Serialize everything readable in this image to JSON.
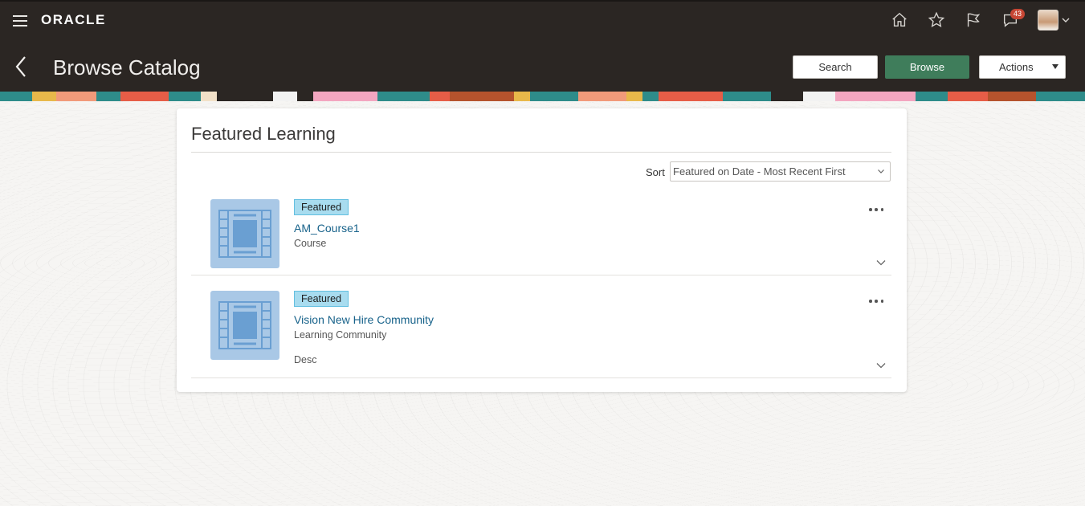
{
  "header": {
    "logo": "ORACLE",
    "page_title": "Browse Catalog",
    "notifications_count": "43",
    "buttons": {
      "search": "Search",
      "browse": "Browse",
      "actions": "Actions"
    },
    "icons": [
      "home-icon",
      "favorites-star-icon",
      "flag-icon",
      "notifications-icon",
      "user-avatar",
      "chevron-down-icon"
    ]
  },
  "colors": {
    "header_bg": "#2b2623",
    "browse_button": "#3f7d5b",
    "link": "#17628a",
    "featured_tag_bg": "#a8dcef",
    "thumbnail_bg": "#a9c8e6",
    "badge": "#c74634"
  },
  "main": {
    "section_title": "Featured Learning",
    "sort": {
      "label": "Sort",
      "selected": "Featured on Date - Most Recent First"
    },
    "items": [
      {
        "tag": "Featured",
        "title": "AM_Course1",
        "type": "Course",
        "description": ""
      },
      {
        "tag": "Featured",
        "title": "Vision New Hire Community",
        "type": "Learning Community",
        "description": "Desc"
      }
    ]
  }
}
